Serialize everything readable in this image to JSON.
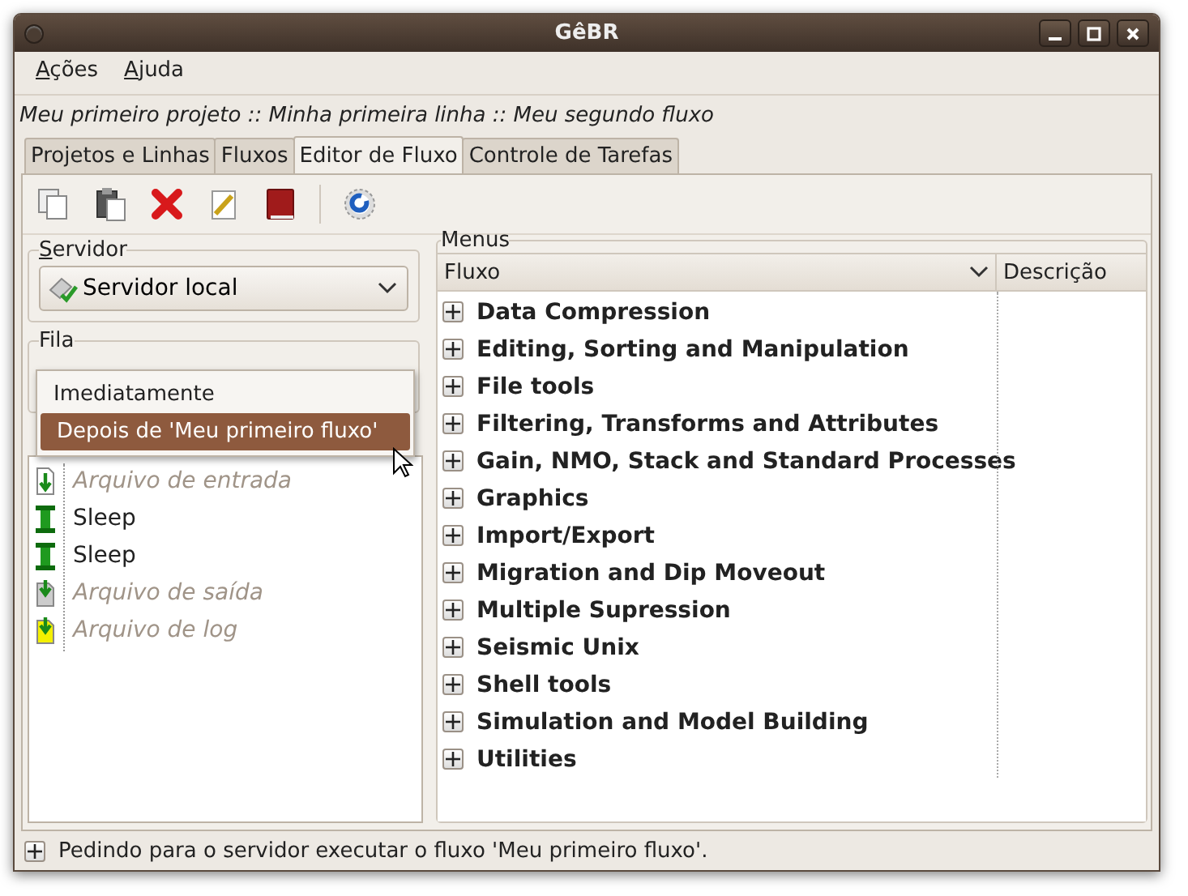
{
  "window": {
    "title": "GêBR"
  },
  "menubar": [
    {
      "label": "Ações"
    },
    {
      "label": "Ajuda"
    }
  ],
  "breadcrumb": "Meu primeiro projeto :: Minha primeira linha :: Meu segundo fluxo",
  "tabs": [
    {
      "label": "Projetos e Linhas",
      "selected": false
    },
    {
      "label": "Fluxos",
      "selected": false
    },
    {
      "label": "Editor de Fluxo",
      "selected": true
    },
    {
      "label": "Controle de Tarefas",
      "selected": false
    }
  ],
  "toolbar": [
    {
      "kind": "copy"
    },
    {
      "kind": "paste"
    },
    {
      "kind": "delete"
    },
    {
      "kind": "edit"
    },
    {
      "kind": "dictionary"
    },
    {
      "kind": "separator"
    },
    {
      "kind": "run"
    }
  ],
  "server": {
    "label": "Servidor",
    "value": "Servidor local"
  },
  "queue": {
    "label": "Fila",
    "options": [
      {
        "label": "Imediatamente",
        "selected": false
      },
      {
        "label": "Depois de 'Meu primeiro fluxo'",
        "selected": true
      }
    ]
  },
  "flow": [
    {
      "kind": "input",
      "label": "Arquivo de entrada"
    },
    {
      "kind": "program",
      "label": "Sleep"
    },
    {
      "kind": "program",
      "label": "Sleep"
    },
    {
      "kind": "output",
      "label": "Arquivo de saída"
    },
    {
      "kind": "log",
      "label": "Arquivo de log"
    }
  ],
  "menus": {
    "label": "Menus",
    "columns": [
      "Fluxo",
      "Descrição"
    ],
    "categories": [
      {
        "label": "Data Compression",
        "expanded": false
      },
      {
        "label": "Editing, Sorting and Manipulation",
        "expanded": false
      },
      {
        "label": "File tools",
        "expanded": false
      },
      {
        "label": "Filtering, Transforms and Attributes",
        "expanded": false
      },
      {
        "label": "Gain, NMO, Stack and Standard Processes",
        "expanded": false
      },
      {
        "label": "Graphics",
        "expanded": false
      },
      {
        "label": "Import/Export",
        "expanded": false
      },
      {
        "label": "Migration and Dip Moveout",
        "expanded": false
      },
      {
        "label": "Multiple Supression",
        "expanded": false
      },
      {
        "label": "Seismic Unix",
        "expanded": false
      },
      {
        "label": "Shell tools",
        "expanded": false
      },
      {
        "label": "Simulation and Model Building",
        "expanded": false
      },
      {
        "label": "Utilities",
        "expanded": false
      }
    ]
  },
  "status_bar": {
    "expanded": false,
    "text": "Pedindo para o servidor executar o fluxo 'Meu primeiro fluxo'."
  }
}
